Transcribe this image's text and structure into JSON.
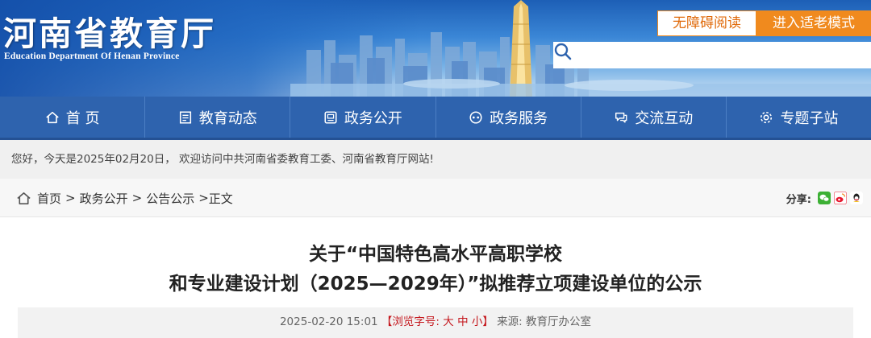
{
  "header": {
    "logo_cn": "河南省教育厅",
    "logo_en": "Education Department Of Henan Province",
    "accessible_label": "无障碍阅读",
    "elder_mode_label": "进入适老模式",
    "search_placeholder": ""
  },
  "nav": {
    "items": [
      {
        "label": "首 页",
        "icon": "home-icon"
      },
      {
        "label": "教育动态",
        "icon": "news-icon"
      },
      {
        "label": "政务公开",
        "icon": "doc-icon"
      },
      {
        "label": "政务服务",
        "icon": "service-icon"
      },
      {
        "label": "交流互动",
        "icon": "chat-icon"
      },
      {
        "label": "专题子站",
        "icon": "gear-icon"
      }
    ]
  },
  "welcome": "您好，今天是2025年02月20日， 欢迎访问中共河南省委教育工委、河南省教育厅网站!",
  "breadcrumb": {
    "items": [
      "首页",
      "政务公开",
      "公告公示"
    ],
    "current": "正文"
  },
  "share": {
    "label": "分享:",
    "icons": [
      "wechat-icon",
      "weibo-icon",
      "qq-icon"
    ],
    "colors": {
      "wechat": "#3cb034",
      "weibo": "#e6162d",
      "qq": "#1d9fe6"
    }
  },
  "article": {
    "title_line1": "关于“中国特色高水平高职学校",
    "title_line2": "和专业建设计划（2025—2029年）”拟推荐立项建设单位的公示",
    "date": "2025-02-20 15:01",
    "font_label": "【浏览字号:",
    "font_large": "大",
    "font_medium": "中",
    "font_small": "小",
    "font_close": "】",
    "source": "来源: 教育厅办公室"
  },
  "colors": {
    "nav_bg": "#2e63ae",
    "accent_orange": "#f08a1e",
    "font_ctl_red": "#c4161c"
  }
}
